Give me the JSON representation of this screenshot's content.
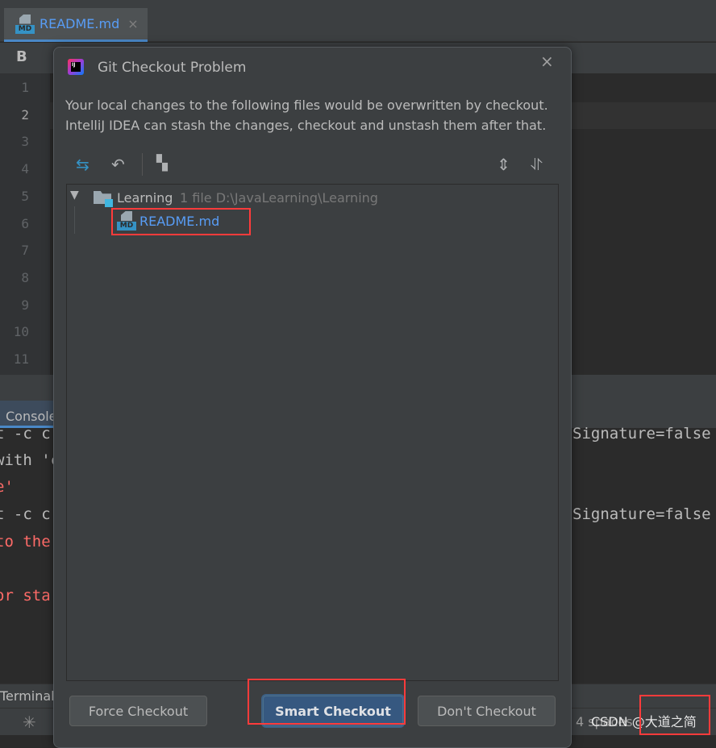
{
  "editor": {
    "tab": {
      "label": "README.md",
      "icon": "markdown-file-icon",
      "close": "×"
    },
    "toolbar": {
      "bold": "B"
    },
    "line_numbers": [
      "1",
      "2",
      "3",
      "4",
      "5",
      "6",
      "7",
      "8",
      "9",
      "10",
      "11"
    ],
    "current_line": "2"
  },
  "console": {
    "tab": "Console",
    "lines": [
      {
        "text": "t -c c",
        "color": "normal"
      },
      {
        "text": "with 'c",
        "color": "normal"
      },
      {
        "text": "e'",
        "color": "error"
      },
      {
        "text": "t -c c",
        "color": "normal"
      },
      {
        "text": "to the",
        "color": "error"
      },
      {
        "text": "or sta",
        "color": "error"
      }
    ],
    "right_lines": [
      "Signature=false",
      "Signature=false"
    ]
  },
  "bottom": {
    "terminal": "Terminal",
    "spinner": "loading-spinner-icon",
    "indent": "4 spaces",
    "watermark": "CSDN @大道之简"
  },
  "dialog": {
    "title": "Git Checkout Problem",
    "close": "×",
    "description": [
      "Your local changes to the following files would be overwritten by checkout.",
      "IntelliJ IDEA can stash the changes, checkout and unstash them after that."
    ],
    "toolbar": [
      "show-diff-icon",
      "rollback-icon",
      "group-by-icon",
      "expand-all-icon",
      "collapse-all-icon"
    ],
    "tree": {
      "folder": "Learning",
      "meta": "1 file  D:\\JavaLearning\\Learning",
      "files": [
        "README.md"
      ]
    },
    "buttons": {
      "force": "Force Checkout",
      "smart": "Smart Checkout",
      "dont": "Don't Checkout"
    }
  },
  "colors": {
    "accent": "#365880",
    "link": "#589df6",
    "error": "#ff6b68",
    "annotation": "#ff3b3b"
  }
}
